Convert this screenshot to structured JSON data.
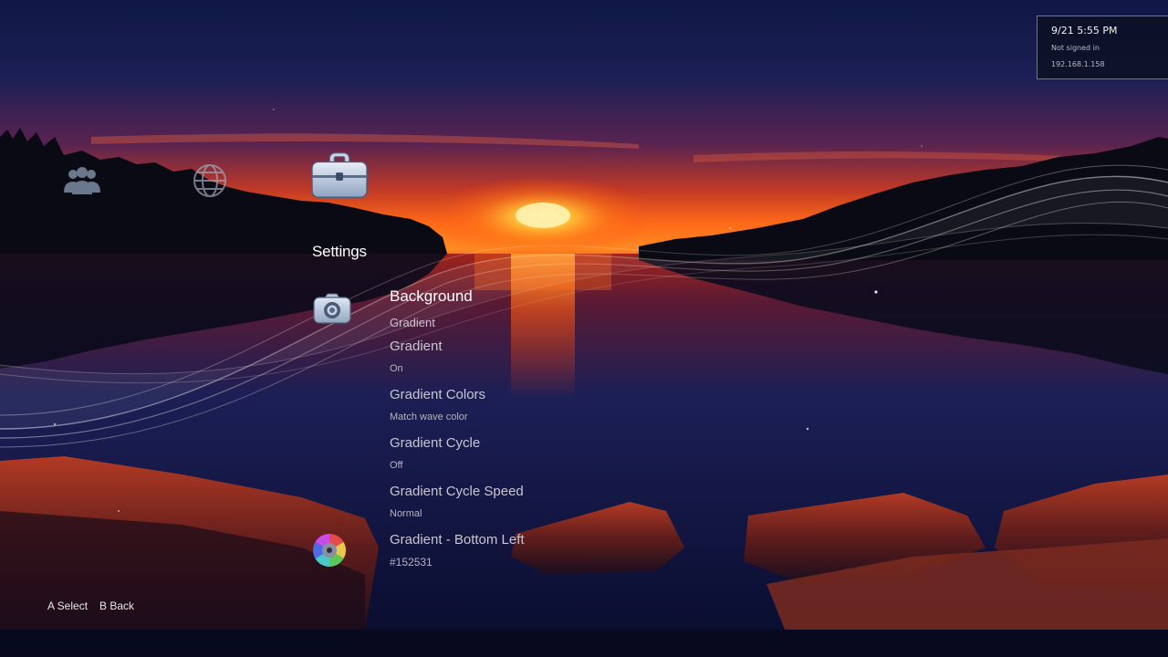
{
  "status": {
    "datetime": "9/21  5:55 PM",
    "sign_in": "Not signed in",
    "ip": "192.168.1.158"
  },
  "categories": [
    {
      "icon": "friends-icon"
    },
    {
      "icon": "network-globe-icon"
    },
    {
      "icon": "toolbox-icon",
      "label": "Settings",
      "selected": true
    }
  ],
  "settings_menu": {
    "section_title": "Background",
    "section_subtitle": "Gradient",
    "items": [
      {
        "label": "Gradient",
        "value": "On"
      },
      {
        "label": "Gradient Colors",
        "value": "Match wave color"
      },
      {
        "label": "Gradient Cycle",
        "value": "Off"
      },
      {
        "label": "Gradient Cycle Speed",
        "value": "Normal"
      },
      {
        "label": "Gradient - Bottom Left",
        "value": "#152531"
      }
    ],
    "icons": [
      "camera-icon",
      "color-wheel-icon"
    ]
  },
  "hints": {
    "select": "A Select",
    "back": "B Back"
  },
  "colors": {
    "sky_top": "#121a45",
    "sunset": "#ff5a14",
    "water": "#0e1640",
    "rocks": "#8a2a1c"
  }
}
